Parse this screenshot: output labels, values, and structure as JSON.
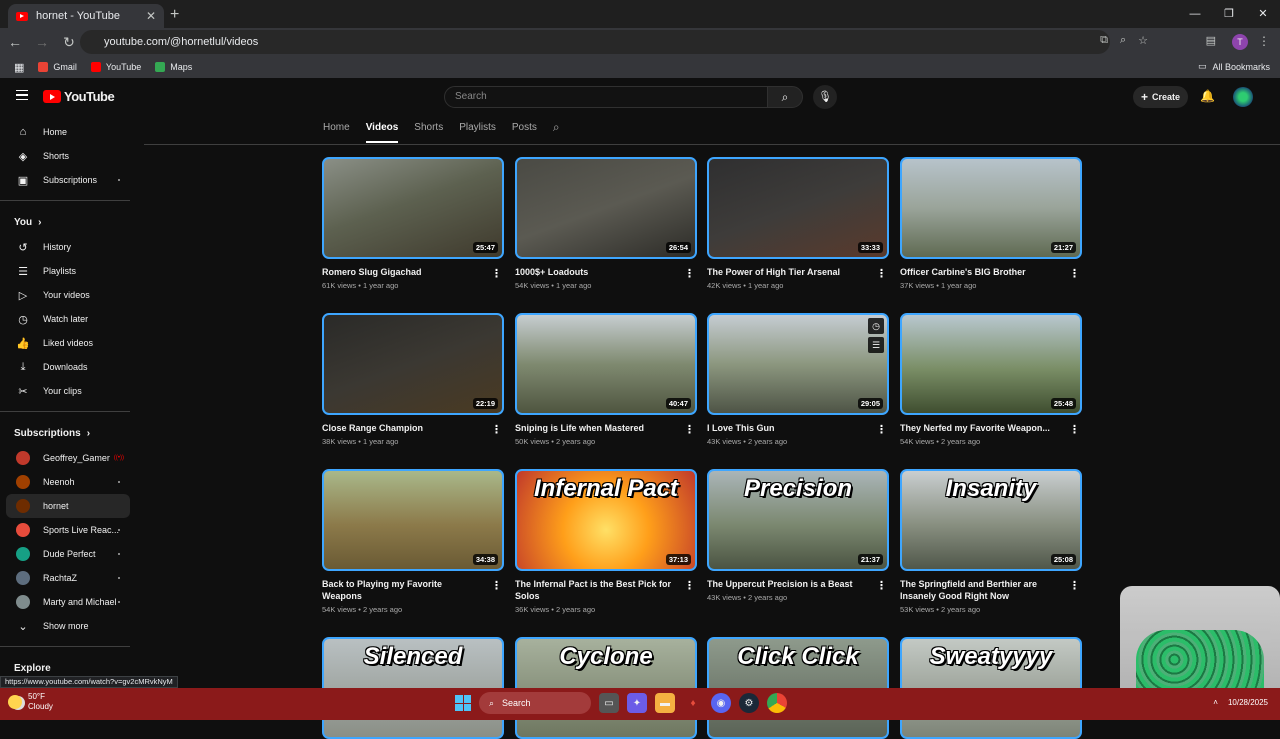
{
  "browser": {
    "tab_title": "hornet - YouTube",
    "new_tab": "+",
    "url": "youtube.com/@hornetlul/videos",
    "profile_initial": "T",
    "bookmarks": [
      {
        "label": "Gmail",
        "color": "#ea4335"
      },
      {
        "label": "YouTube",
        "color": "#ff0000"
      },
      {
        "label": "Maps",
        "color": "#34a853"
      }
    ],
    "all_bookmarks": "All Bookmarks"
  },
  "youtube": {
    "logo": "YouTube",
    "search_placeholder": "Search",
    "create_label": "Create"
  },
  "sidebar": {
    "main": [
      {
        "label": "Home",
        "icon": "home-icon",
        "glyph": "⌂"
      },
      {
        "label": "Shorts",
        "icon": "shorts-icon",
        "glyph": "◈"
      },
      {
        "label": "Subscriptions",
        "icon": "subscriptions-icon",
        "glyph": "▣"
      }
    ],
    "you_label": "You",
    "you": [
      {
        "label": "History",
        "icon": "history-icon",
        "glyph": "↺"
      },
      {
        "label": "Playlists",
        "icon": "playlists-icon",
        "glyph": "☰"
      },
      {
        "label": "Your videos",
        "icon": "your-videos-icon",
        "glyph": "▷"
      },
      {
        "label": "Watch later",
        "icon": "watch-later-icon",
        "glyph": "◷"
      },
      {
        "label": "Liked videos",
        "icon": "liked-icon",
        "glyph": "👍"
      },
      {
        "label": "Downloads",
        "icon": "download-icon",
        "glyph": "⤓"
      },
      {
        "label": "Your clips",
        "icon": "clips-icon",
        "glyph": "✂"
      }
    ],
    "subscriptions_label": "Subscriptions",
    "subscriptions": [
      {
        "label": "Geoffrey_Gamer",
        "color": "#c0392b",
        "live": true
      },
      {
        "label": "Neenoh",
        "color": "#a04000",
        "live": false
      },
      {
        "label": "hornet",
        "color": "#6e2c00",
        "live": false,
        "active": true
      },
      {
        "label": "Sports Live Reac...",
        "color": "#e74c3c",
        "live": false
      },
      {
        "label": "Dude Perfect",
        "color": "#16a085",
        "live": false
      },
      {
        "label": "RachtaZ",
        "color": "#5d6d7e",
        "live": false
      },
      {
        "label": "Marty and Michael",
        "color": "#7f8c8d",
        "live": false
      }
    ],
    "show_more": "Show more",
    "explore_label": "Explore"
  },
  "channel_tabs": [
    {
      "label": "Home",
      "active": false
    },
    {
      "label": "Videos",
      "active": true
    },
    {
      "label": "Shorts",
      "active": false
    },
    {
      "label": "Playlists",
      "active": false
    },
    {
      "label": "Posts",
      "active": false
    }
  ],
  "videos": [
    {
      "title": "Romero Slug Gigachad",
      "meta": "61K views • 1 year ago",
      "duration": "25:47",
      "overlay": "",
      "bg": "linear-gradient(160deg,#8a8f86 0%,#5d6150 45%,#3f3a2d 100%)"
    },
    {
      "title": "1000$+ Loadouts",
      "meta": "54K views • 1 year ago",
      "duration": "26:54",
      "overlay": "",
      "bg": "linear-gradient(160deg,#4a4a44 0%,#5b5a52 50%,#2d2c28 100%)"
    },
    {
      "title": "The Power of High Tier Arsenal",
      "meta": "42K views • 1 year ago",
      "duration": "33:33",
      "overlay": "",
      "bg": "linear-gradient(160deg,#2f2f30 0%,#3e3c3a 50%,#5a3a2c 100%)"
    },
    {
      "title": "Officer Carbine's BIG Brother",
      "meta": "37K views • 1 year ago",
      "duration": "21:27",
      "overlay": "",
      "bg": "linear-gradient(180deg,#b7c3cb 0%,#9aa49a 50%,#5f6a52 100%)"
    },
    {
      "title": "Close Range Champion",
      "meta": "38K views • 1 year ago",
      "duration": "22:19",
      "overlay": "",
      "bg": "linear-gradient(160deg,#2a2a28 0%,#3b3832 50%,#4a3a22 100%)"
    },
    {
      "title": "Sniping is Life when Mastered",
      "meta": "50K views • 2 years ago",
      "duration": "40:47",
      "overlay": "",
      "bg": "linear-gradient(180deg,#c6cdd0 0%,#7f8a70 50%,#4f5540 100%)"
    },
    {
      "title": "I Love This Gun",
      "meta": "43K views • 2 years ago",
      "duration": "29:05",
      "overlay": "",
      "hover": true,
      "bg": "linear-gradient(180deg,#c5ccd2 0%,#8c977f 50%,#4e5446 100%)"
    },
    {
      "title": "They Nerfed my Favorite Weapon...",
      "meta": "54K views • 2 years ago",
      "duration": "25:48",
      "overlay": "",
      "bg": "linear-gradient(180deg,#b8c7cf 0%,#7a8e66 55%,#3f4e30 100%)"
    },
    {
      "title": "Back to Playing my Favorite Weapons",
      "meta": "54K views • 2 years ago",
      "duration": "34:38",
      "overlay": "",
      "bg": "linear-gradient(180deg,#a9b88a 0%,#8c7a4a 55%,#6a5a34 100%)"
    },
    {
      "title": "The Infernal Pact is the Best Pick for Solos",
      "meta": "36K views • 2 years ago",
      "duration": "37:13",
      "overlay": "Infernal Pact",
      "bg": "radial-gradient(circle at 50% 60%,#ffe066 0%,#ff9f1a 40%,#c0392b 100%)"
    },
    {
      "title": "The Uppercut Precision is a Beast",
      "meta": "43K views • 2 years ago",
      "duration": "21:37",
      "overlay": "Precision",
      "bg": "linear-gradient(180deg,#aab5b8 0%,#7b8870 55%,#4b5442 100%)"
    },
    {
      "title": "The Springfield and Berthier are Insanely Good Right Now",
      "meta": "53K views • 2 years ago",
      "duration": "25:08",
      "overlay": "Insanity",
      "bg": "linear-gradient(180deg,#c9ced0 0%,#888f80 55%,#50574a 100%)"
    },
    {
      "title": "",
      "meta": "",
      "duration": "",
      "overlay": "Silenced",
      "bg": "linear-gradient(180deg,#b9c0c2 0%,#8a8f86 100%)"
    },
    {
      "title": "",
      "meta": "",
      "duration": "",
      "overlay": "Cyclone",
      "bg": "linear-gradient(180deg,#a7b19d 0%,#6e7760 100%)"
    },
    {
      "title": "",
      "meta": "",
      "duration": "",
      "overlay": "Click Click",
      "bg": "linear-gradient(180deg,#8e9a8c 0%,#5a6356 100%)"
    },
    {
      "title": "",
      "meta": "",
      "duration": "",
      "overlay": "Sweatyyyy",
      "bg": "linear-gradient(180deg,#c3c9c4 0%,#7d8477 100%)"
    }
  ],
  "status_url": "https://www.youtube.com/watch?v=gv2cMRvkNyM",
  "taskbar": {
    "temp": "50°F",
    "condition": "Cloudy",
    "search_label": "Search",
    "date": "10/28/2025"
  }
}
